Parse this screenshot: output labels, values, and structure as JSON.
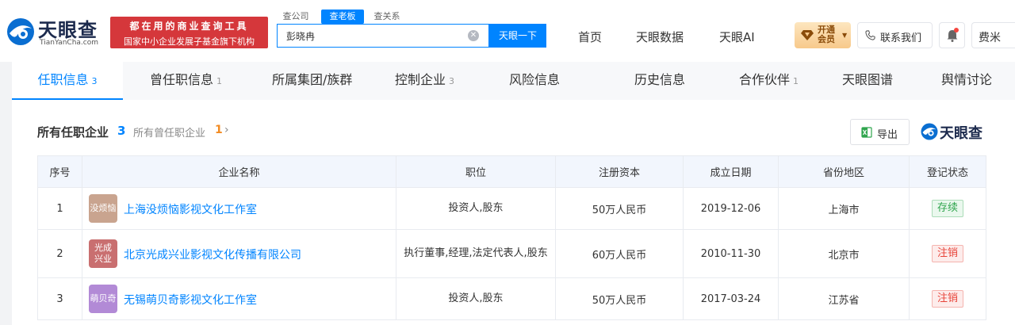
{
  "header": {
    "logo_text": "天眼查",
    "logo_sub": "TianYanCha.com",
    "slogan_line1": "都在用的商业查询工具",
    "slogan_line2": "国家中小企业发展子基金旗下机构",
    "search_tabs": [
      "查公司",
      "查老板",
      "查关系"
    ],
    "search_value": "彭晓冉",
    "search_button": "天眼一下",
    "nav": [
      "首页",
      "天眼数据",
      "天眼AI"
    ],
    "vip_label": "开通会员",
    "contact_label": "联系我们",
    "user_name": "费米"
  },
  "tabs": [
    {
      "label": "任职信息",
      "count": "3"
    },
    {
      "label": "曾任职信息",
      "count": "1"
    },
    {
      "label": "所属集团/族群",
      "count": ""
    },
    {
      "label": "控制企业",
      "count": "3"
    },
    {
      "label": "风险信息",
      "count": ""
    },
    {
      "label": "历史信息",
      "count": ""
    },
    {
      "label": "合作伙伴",
      "count": "1"
    },
    {
      "label": "天眼图谱",
      "count": ""
    },
    {
      "label": "舆情讨论",
      "count": ""
    }
  ],
  "section": {
    "title": "所有任职企业",
    "count": "3",
    "former_label": "所有曾任职企业",
    "former_count": "1",
    "export_label": "导出",
    "watermark": "天眼查"
  },
  "table": {
    "headers": [
      "序号",
      "企业名称",
      "职位",
      "注册资本",
      "成立日期",
      "省份地区",
      "登记状态"
    ],
    "rows": [
      {
        "no": "1",
        "logo_text": "没烦恼",
        "logo_color": "#c9a48f",
        "name": "上海没烦恼影视文化工作室",
        "position": "投资人,股东",
        "capital": "50万人民币",
        "date": "2019-12-06",
        "region": "上海市",
        "status": "存续",
        "status_type": "ok"
      },
      {
        "no": "2",
        "logo_text": "光成\n兴业",
        "logo_color": "#c96f70",
        "name": "北京光成兴业影视文化传播有限公司",
        "position": "执行董事,经理,法定代表人,股东",
        "capital": "60万人民币",
        "date": "2010-11-30",
        "region": "北京市",
        "status": "注销",
        "status_type": "bad"
      },
      {
        "no": "3",
        "logo_text": "萌贝奇",
        "logo_color": "#b28ad6",
        "name": "无锡萌贝奇影视文化工作室",
        "position": "投资人,股东",
        "capital": "50万人民币",
        "date": "2017-03-24",
        "region": "江苏省",
        "status": "注销",
        "status_type": "bad"
      }
    ]
  },
  "colors": {
    "accent": "#0084ff",
    "slogan_red": "#d5373b",
    "status_ok_text": "#2fa54d",
    "status_ok_bg": "#eaf8ee",
    "status_bad_text": "#e8443a",
    "status_bad_bg": "#fdeceb"
  }
}
